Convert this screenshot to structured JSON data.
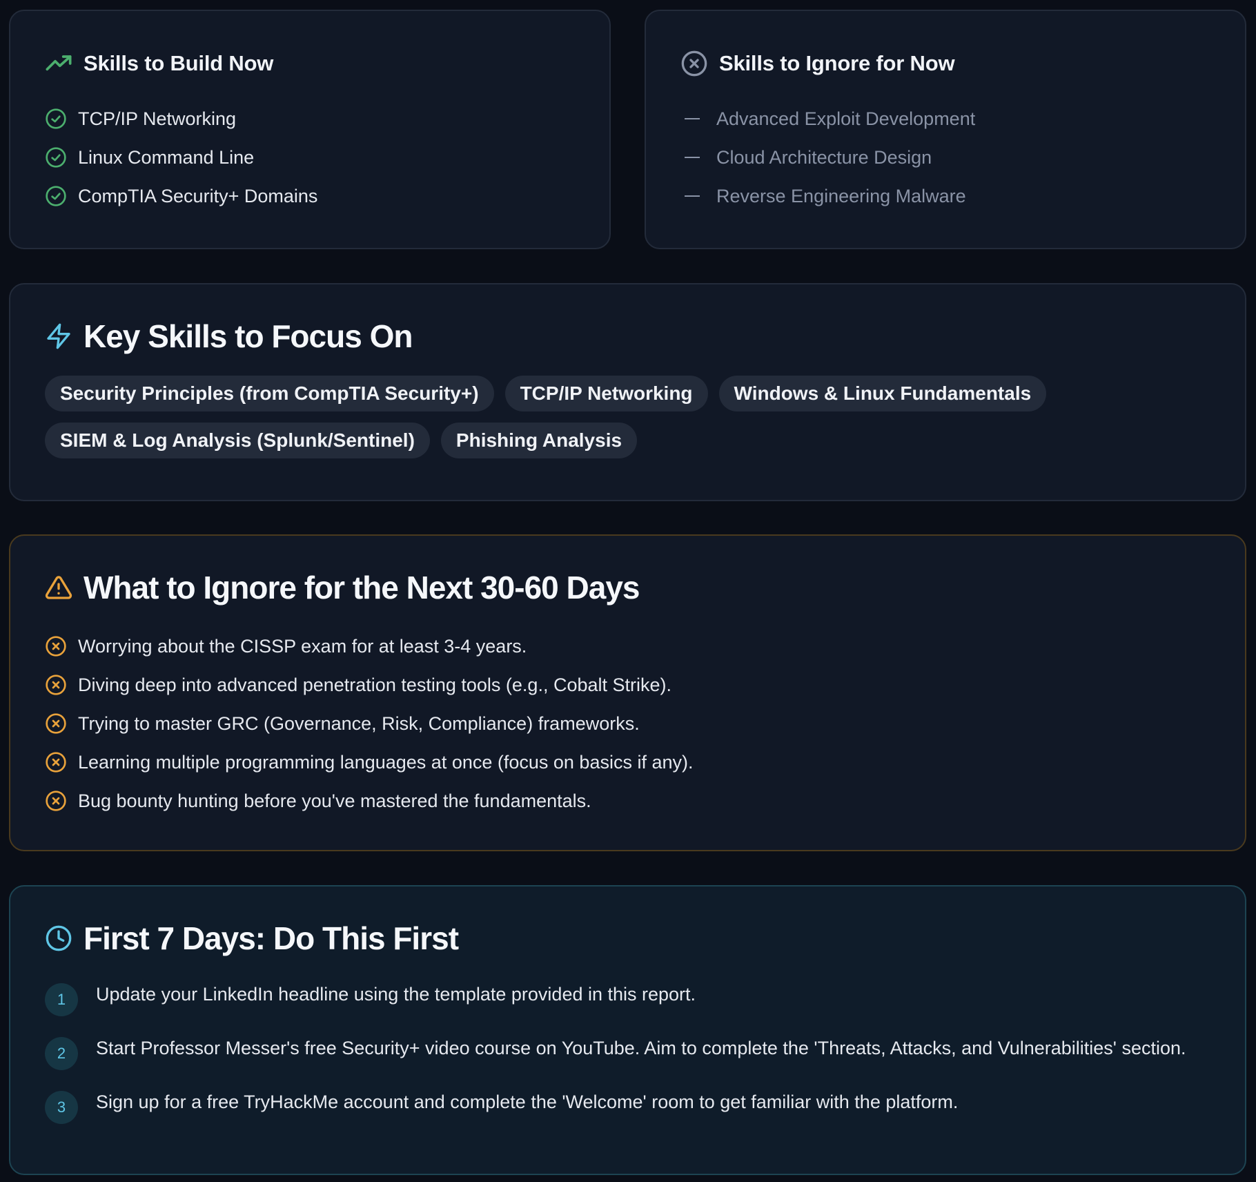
{
  "build_now": {
    "title": "Skills to Build Now",
    "items": [
      "TCP/IP Networking",
      "Linux Command Line",
      "CompTIA Security+ Domains"
    ]
  },
  "ignore_now": {
    "title": "Skills to Ignore for Now",
    "items": [
      "Advanced Exploit Development",
      "Cloud Architecture Design",
      "Reverse Engineering Malware"
    ]
  },
  "key_skills": {
    "title": "Key Skills to Focus On",
    "pills": [
      "Security Principles (from CompTIA Security+)",
      "TCP/IP Networking",
      "Windows & Linux Fundamentals",
      "SIEM & Log Analysis (Splunk/Sentinel)",
      "Phishing Analysis"
    ]
  },
  "ignore_days": {
    "title": "What to Ignore for the Next 30-60 Days",
    "items": [
      "Worrying about the CISSP exam for at least 3-4 years.",
      "Diving deep into advanced penetration testing tools (e.g., Cobalt Strike).",
      "Trying to master GRC (Governance, Risk, Compliance) frameworks.",
      "Learning multiple programming languages at once (focus on basics if any).",
      "Bug bounty hunting before you've mastered the fundamentals."
    ]
  },
  "first_days": {
    "title": "First 7 Days: Do This First",
    "steps": [
      {
        "num": "1",
        "text": "Update your LinkedIn headline using the template provided in this report."
      },
      {
        "num": "2",
        "text": "Start Professor Messer's free Security+ video course on YouTube. Aim to complete the 'Threats, Attacks, and Vulnerabilities' section."
      },
      {
        "num": "3",
        "text": "Sign up for a free TryHackMe account and complete the 'Welcome' room to get familiar with the platform."
      }
    ]
  },
  "icons": {
    "build": "trending-up-icon",
    "ignore": "x-circle-icon",
    "key": "lightning-icon",
    "warn": "warning-triangle-icon",
    "clock": "clock-icon",
    "check": "check-circle-icon"
  },
  "colors": {
    "green": "#4caf6e",
    "gray": "#8a93a6",
    "cyan": "#5fc6e6",
    "orange": "#e9a23b"
  }
}
